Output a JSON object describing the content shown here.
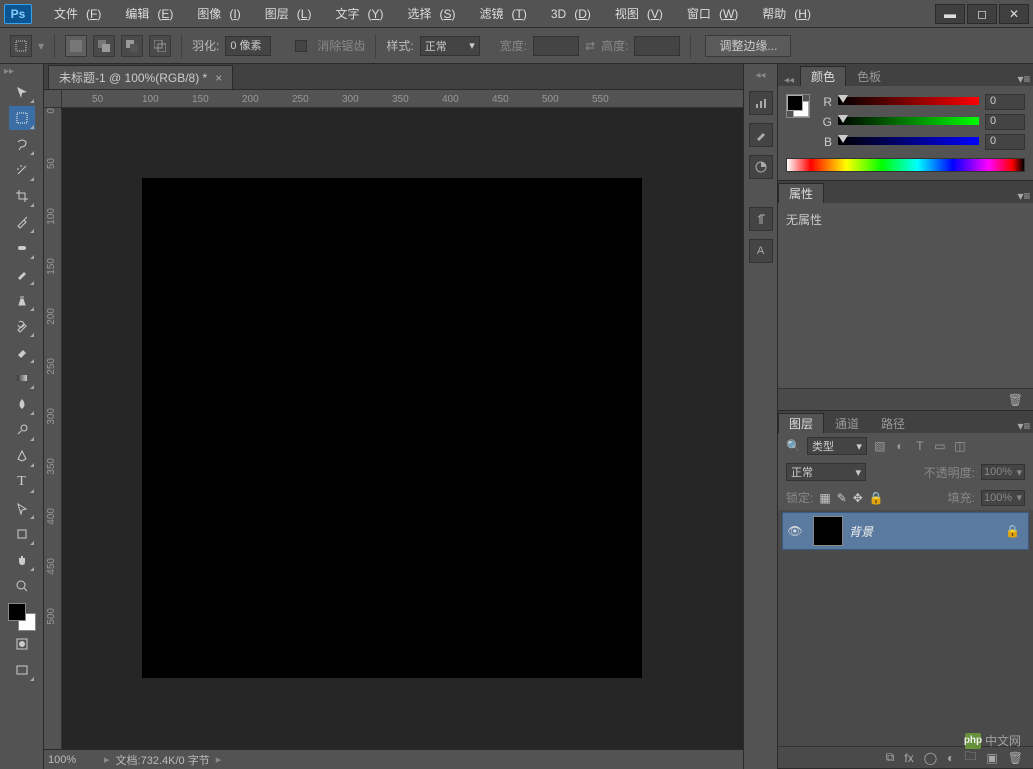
{
  "app": {
    "badge": "Ps"
  },
  "menu": [
    {
      "t": "文件",
      "u": "F"
    },
    {
      "t": "编辑",
      "u": "E"
    },
    {
      "t": "图像",
      "u": "I"
    },
    {
      "t": "图层",
      "u": "L"
    },
    {
      "t": "文字",
      "u": "Y"
    },
    {
      "t": "选择",
      "u": "S"
    },
    {
      "t": "滤镜",
      "u": "T"
    },
    {
      "t": "3D",
      "u": "D"
    },
    {
      "t": "视图",
      "u": "V"
    },
    {
      "t": "窗口",
      "u": "W"
    },
    {
      "t": "帮助",
      "u": "H"
    }
  ],
  "options": {
    "feather_label": "羽化:",
    "feather_value": "0 像素",
    "antialias_label": "消除锯齿",
    "style_label": "样式:",
    "style_value": "正常",
    "width_label": "宽度:",
    "height_label": "高度:",
    "refine_label": "调整边缘..."
  },
  "document": {
    "tab_title": "未标题-1 @ 100%(RGB/8) *"
  },
  "ruler_h": [
    " ",
    "50",
    "100",
    "150",
    "200",
    "250",
    "300",
    "350",
    "400",
    "450",
    "500",
    "550"
  ],
  "ruler_v": [
    "0",
    "50",
    "100",
    "150",
    "200",
    "250",
    "300",
    "350",
    "400",
    "450",
    "500"
  ],
  "status": {
    "zoom": "100%",
    "doc_label": "文档:",
    "doc_value": "732.4K/0 字节"
  },
  "panels": {
    "color": {
      "tab1": "颜色",
      "tab2": "色板",
      "r": "R",
      "g": "G",
      "b": "B",
      "val": "0"
    },
    "props": {
      "tab": "属性",
      "empty": "无属性"
    },
    "layers": {
      "tab1": "图层",
      "tab2": "通道",
      "tab3": "路径",
      "kind_label": "类型",
      "blend": "正常",
      "opacity_label": "不透明度:",
      "opacity_val": "100%",
      "lock_label": "锁定:",
      "fill_label": "填充:",
      "fill_val": "100%",
      "layer_name": "背景"
    }
  },
  "watermark": "中文网",
  "watermark_prefix": "php"
}
